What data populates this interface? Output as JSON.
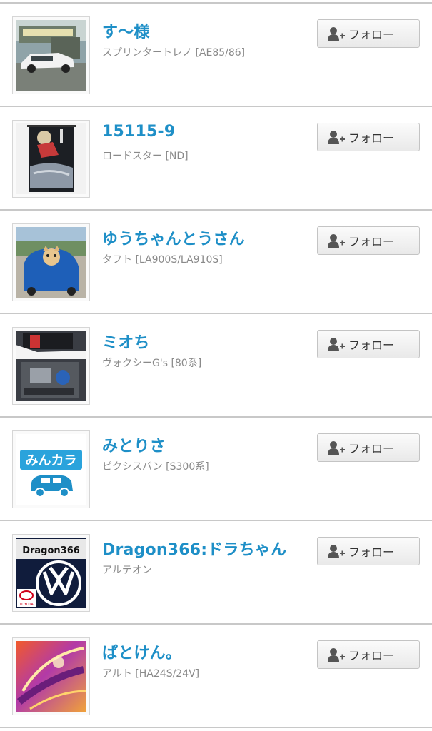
{
  "follow_label": "フォロー",
  "users": [
    {
      "name": "す〜様",
      "car": "スプリンタートレノ [AE85/86]",
      "avatar": "white-ae86-car-photo"
    },
    {
      "name": "15115-9",
      "car": "ロードスター [ND]",
      "avatar": "anime-poster-photo"
    },
    {
      "name": "ゆうちゃんとうさん",
      "car": "タフト [LA900S/LA910S]",
      "avatar": "dog-in-blue-car-photo"
    },
    {
      "name": "ミオち",
      "car": "ヴォクシーG's [80系]",
      "avatar": "engine-bay-photo"
    },
    {
      "name": "みとりさ",
      "car": "ピクシスバン [S300系]",
      "avatar": "minkara-default-avatar"
    },
    {
      "name": "Dragon366:ドラちゃん",
      "car": "アルテオン",
      "avatar": "dragon366-vw-logo"
    },
    {
      "name": "ぱとけん。",
      "car": "アルト [HA24S/24V]",
      "avatar": "headlight-art-photo"
    }
  ],
  "avatar_texts": {
    "minkara": "みんカラ",
    "dragon": "Dragon366",
    "toyota": "TOYOTA"
  },
  "colors": {
    "name": "#1e8fc7",
    "car_text": "#8a8a8a",
    "divider": "#c8c8c8",
    "button_text": "#333333"
  }
}
